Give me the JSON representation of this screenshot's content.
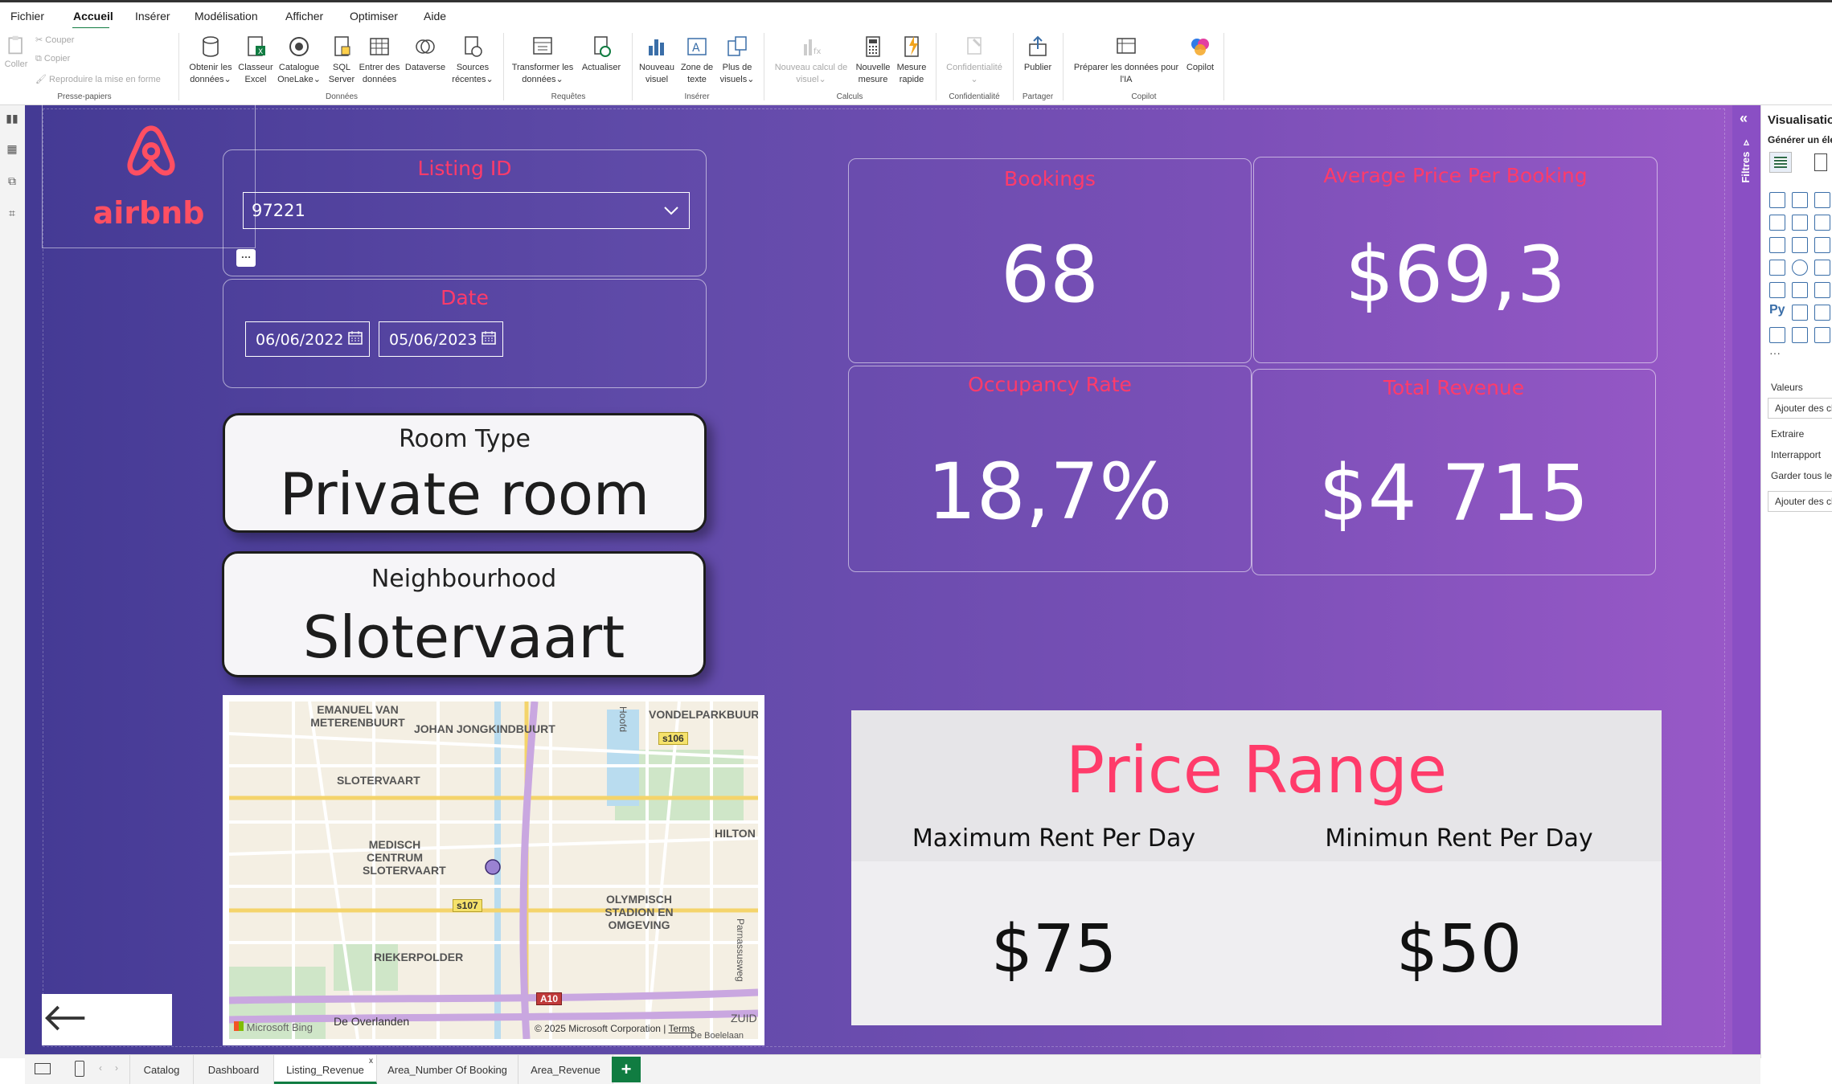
{
  "menu": {
    "tabs": [
      "Fichier",
      "Accueil",
      "Insérer",
      "Modélisation",
      "Afficher",
      "Optimiser",
      "Aide"
    ],
    "active": "Accueil"
  },
  "ribbon": {
    "clipboard": {
      "coller": "Coller",
      "couper": "Couper",
      "copier": "Copier",
      "reproduire": "Reproduire la mise en forme",
      "group": "Presse-papiers"
    },
    "data": {
      "obtenir": "Obtenir les données",
      "classeur": "Classeur Excel",
      "catalogue": "Catalogue OneLake",
      "sql": "SQL Server",
      "entrer": "Entrer des données",
      "dataverse": "Dataverse",
      "sources": "Sources récentes",
      "group": "Données"
    },
    "queries": {
      "transformer": "Transformer les données",
      "actualiser": "Actualiser",
      "group": "Requêtes"
    },
    "insert": {
      "nouveau_visuel": "Nouveau visuel",
      "zone_texte": "Zone de texte",
      "plus_visuels": "Plus de visuels",
      "group": "Insérer"
    },
    "calc": {
      "nouveau_calcul": "Nouveau calcul de visuel",
      "nouvelle_mesure": "Nouvelle mesure",
      "mesure_rapide": "Mesure rapide",
      "group": "Calculs"
    },
    "conf": {
      "label": "Confidentialité",
      "group": "Confidentialité"
    },
    "share": {
      "publier": "Publier",
      "group": "Partager"
    },
    "copilot": {
      "preparer": "Préparer les données pour l'IA",
      "copilot": "Copilot",
      "group": "Copilot"
    }
  },
  "report": {
    "logo_text": "airbnb",
    "listing": {
      "title": "Listing ID",
      "value": "97221"
    },
    "date": {
      "title": "Date",
      "start": "06/06/2022",
      "end": "05/06/2023"
    },
    "room_type": {
      "label": "Room Type",
      "value": "Private room"
    },
    "neighbourhood": {
      "label": "Neighbourhood",
      "value": "Slotervaart"
    },
    "kpis": {
      "bookings": {
        "title": "Bookings",
        "value": "68"
      },
      "avg_price": {
        "title": "Average Price Per Booking",
        "value": "$69,3"
      },
      "occupancy": {
        "title": "Occupancy Rate",
        "value": "18,7%"
      },
      "revenue": {
        "title": "Total Revenue",
        "value": "$4 715"
      }
    },
    "price_range": {
      "title": "Price Range",
      "max_label": "Maximum Rent Per Day",
      "min_label": "Minimun Rent Per Day",
      "max_value": "$75",
      "min_value": "$50"
    },
    "map": {
      "labels": [
        "EMANUEL VAN METERENBUURT",
        "JOHAN JONGKINDBUURT",
        "VONDELPARKBUURT",
        "SLOTERVAART",
        "MEDISCH CENTRUM SLOTERVAART",
        "HILTON",
        "OLYMPISCH STADION EN OMGEVING",
        "RIEKERPOLDER",
        "De Overlanden",
        "ZUID",
        "Hoofd",
        "Parnassusweg"
      ],
      "shields": [
        "s106",
        "s107",
        "A10"
      ],
      "brand": "Microsoft Bing",
      "copyright": "© 2025 Microsoft Corporation",
      "terms": "Terms",
      "extra": "De Boelelaan"
    }
  },
  "pages": [
    "Catalog",
    "Dashboard",
    "Listing_Revenue",
    "Area_Number Of Booking",
    "Area_Revenue"
  ],
  "active_page": "Listing_Revenue",
  "filters_label": "Filtres",
  "viz_pane": {
    "title": "Visualisations",
    "sub": "Générer un élé",
    "values": "Valeurs",
    "add_fields": "Ajouter des ch",
    "extract": "Extraire",
    "cross": "Interrapport",
    "keep": "Garder tous les",
    "add_fields2": "Ajouter des ch"
  },
  "colors": {
    "accent": "#ff3b6a",
    "canvas_start": "#443a94",
    "canvas_end": "#9a59c8",
    "excel_green": "#107c41"
  }
}
